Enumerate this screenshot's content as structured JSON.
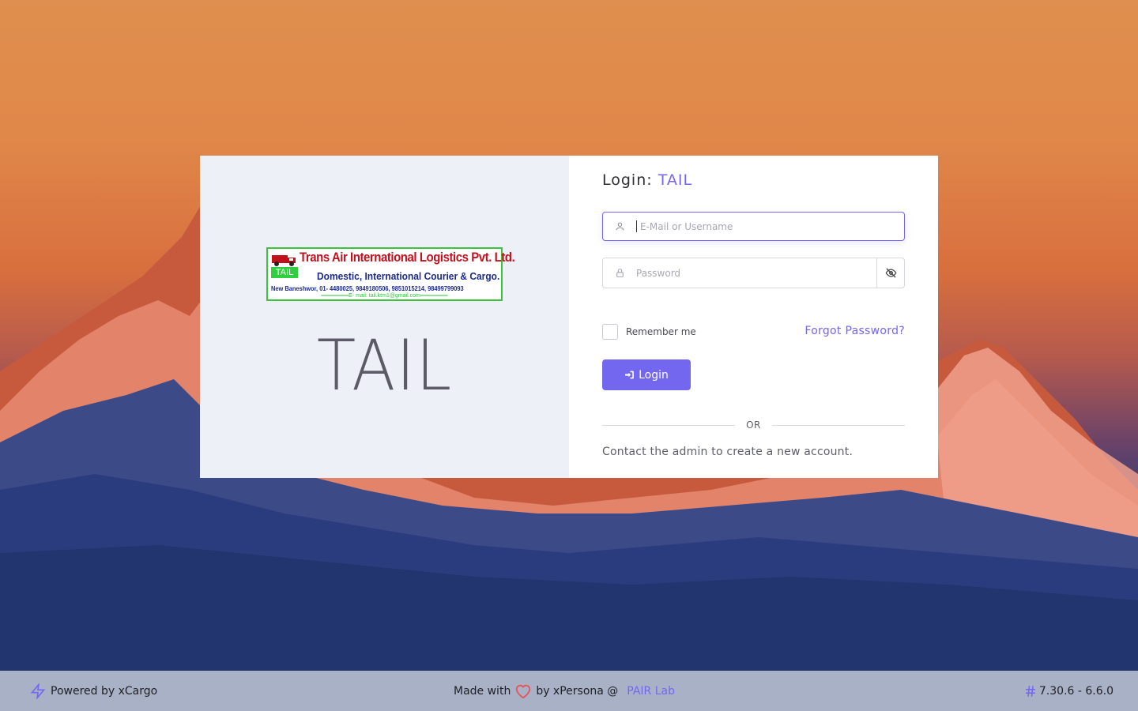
{
  "brand": {
    "logo_title": "Trans Air International Logistics Pvt. Ltd.",
    "logo_badge": "TAIL",
    "logo_subtitle": "Domestic, International Courier & Cargo.",
    "logo_contact": "New Baneshwor, 01- 4480025, 9849180506, 9851015214, 98499799093",
    "logo_email": "═══════E- mail: tail.ktm1@gmail.com═══════",
    "big_text": "TAIL"
  },
  "login": {
    "title_prefix": "Login:",
    "title_org": "TAIL",
    "email_placeholder": "E-Mail or Username",
    "email_value": "",
    "password_placeholder": "Password",
    "password_value": "",
    "remember_label": "Remember me",
    "forgot_label": "Forgot Password?",
    "button_label": "Login",
    "divider_label": "OR",
    "contact_text": "Contact the admin to create a new account."
  },
  "footer": {
    "powered_by": "Powered by xCargo",
    "made_with": "Made with",
    "by_text": "by xPersona @",
    "lab": "PAIR Lab",
    "version": "7.30.6 - 6.6.0"
  },
  "colors": {
    "accent": "#7367f0",
    "card_left_bg": "#eef0f7",
    "footer_bg": "#a8b1c6",
    "heart": "#ea5455"
  },
  "icons": [
    "user-icon",
    "lock-icon",
    "eye-off-icon",
    "sign-in-icon",
    "bolt-icon",
    "heart-icon",
    "hash-icon"
  ]
}
